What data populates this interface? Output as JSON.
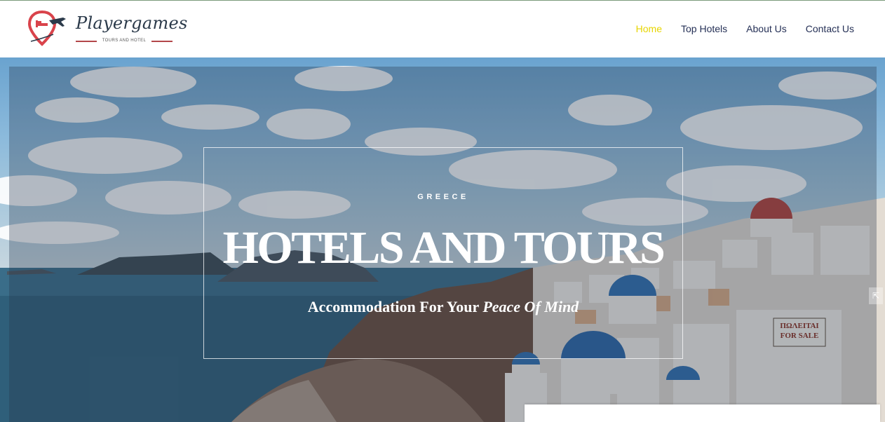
{
  "brand": {
    "name": "Playergames",
    "tagline": "TOURS AND HOTEL"
  },
  "nav": {
    "items": [
      {
        "label": "Home",
        "active": true
      },
      {
        "label": "Top Hotels",
        "active": false
      },
      {
        "label": "About Us",
        "active": false
      },
      {
        "label": "Contact Us",
        "active": false
      }
    ]
  },
  "hero": {
    "eyebrow": "GREECE",
    "title": "HOTELS AND TOURS",
    "subtitle_plain": "Accommodation For Your",
    "subtitle_italic": "Peace Of Mind",
    "sign_line1": "ΠΩΛΕΙΤΑΙ",
    "sign_line2": "FOR SALE"
  },
  "colors": {
    "nav_active": "#e7d500",
    "nav_text": "#253056",
    "brand_accent": "#b3474a",
    "logo_pin": "#d9434b"
  },
  "icons": {
    "logo": "map-pin-with-bed-and-airplane",
    "side_widget": "expand-icon"
  }
}
